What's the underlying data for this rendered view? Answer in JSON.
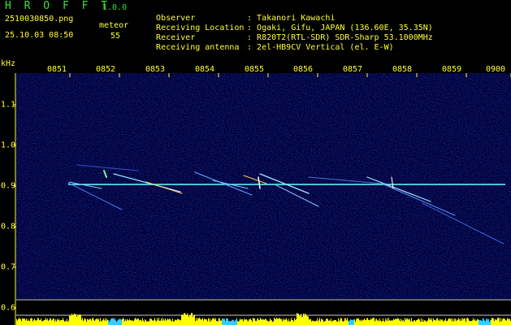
{
  "header": {
    "app_title": "H R O F F T",
    "app_version": "1.0.0",
    "file_name": "2510030850.png",
    "date_time": "25.10.03 08:50",
    "meteor_label": "meteor",
    "meteor_count": "55"
  },
  "info": [
    {
      "key": "Observer",
      "value": "Takanori Kawachi"
    },
    {
      "key": "Receiving Location",
      "value": "Ogaki, Gifu, JAPAN (136.60E, 35.35N)"
    },
    {
      "key": "Receiver",
      "value": "R820T2(RTL-SDR) SDR-Sharp 53.1000MHz"
    },
    {
      "key": "Receiving antenna",
      "value": "2el-HB9CV Vertical (el. E-W)"
    }
  ],
  "axis": {
    "y_unit": "kHz",
    "x_ticks": [
      "0851",
      "0852",
      "0853",
      "0854",
      "0855",
      "0856",
      "0857",
      "0858",
      "0859",
      "0900"
    ],
    "y_ticks": [
      "1.1",
      "1.0",
      "0.9",
      "0.8",
      "0.7",
      "0.6"
    ]
  },
  "colors": {
    "text": "#ffff33",
    "title": "#33e633",
    "background": "#00003a",
    "carrier": "#66ffff",
    "level_bar": "#ffff00"
  }
}
